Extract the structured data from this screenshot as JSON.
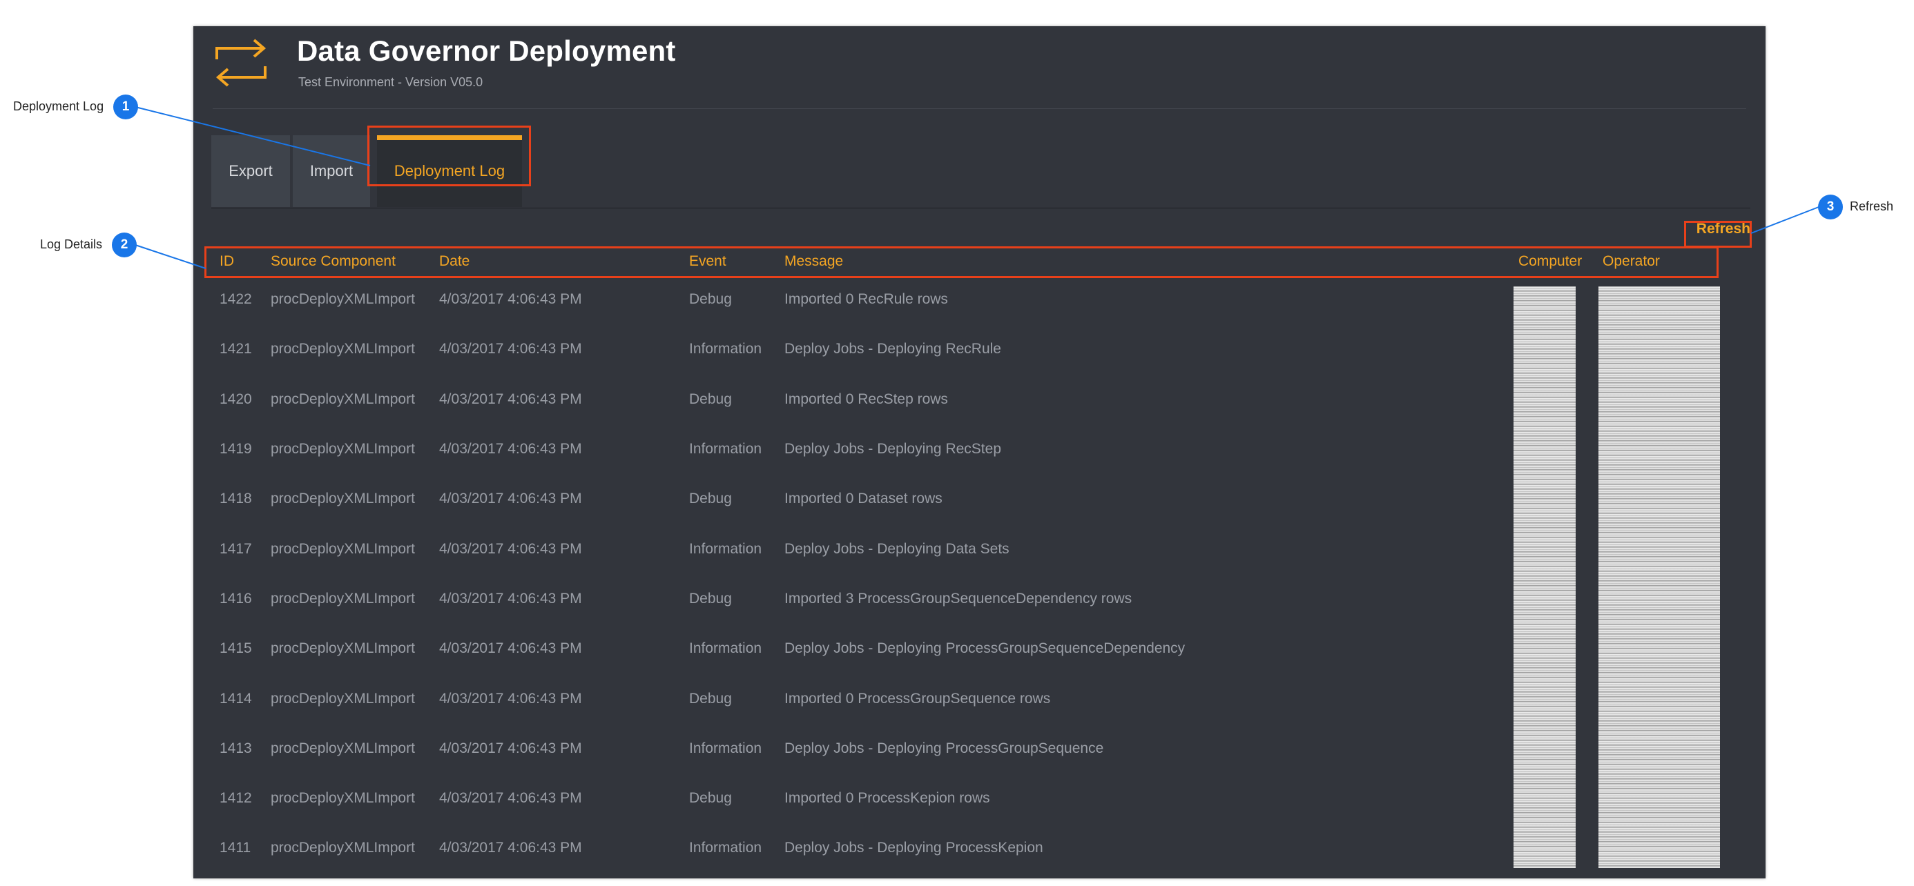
{
  "app": {
    "title": "Data Governor Deployment",
    "subtitle": "Test Environment - Version V05.0",
    "icon": "transfer-arrows-icon",
    "accent_color": "#f5a623"
  },
  "tabs": [
    {
      "label": "Export",
      "active": false
    },
    {
      "label": "Import",
      "active": false
    },
    {
      "label": "Deployment Log",
      "active": true
    }
  ],
  "refresh_label": "Refresh",
  "log": {
    "columns": [
      "ID",
      "Source Component",
      "Date",
      "Event",
      "Message",
      "Computer",
      "Operator"
    ],
    "rows": [
      {
        "id": "1422",
        "source": "procDeployXMLImport",
        "date": "4/03/2017 4:06:43 PM",
        "event": "Debug",
        "message": "Imported 0 RecRule rows"
      },
      {
        "id": "1421",
        "source": "procDeployXMLImport",
        "date": "4/03/2017 4:06:43 PM",
        "event": "Information",
        "message": "Deploy Jobs - Deploying RecRule"
      },
      {
        "id": "1420",
        "source": "procDeployXMLImport",
        "date": "4/03/2017 4:06:43 PM",
        "event": "Debug",
        "message": "Imported 0 RecStep rows"
      },
      {
        "id": "1419",
        "source": "procDeployXMLImport",
        "date": "4/03/2017 4:06:43 PM",
        "event": "Information",
        "message": "Deploy Jobs - Deploying RecStep"
      },
      {
        "id": "1418",
        "source": "procDeployXMLImport",
        "date": "4/03/2017 4:06:43 PM",
        "event": "Debug",
        "message": "Imported 0 Dataset rows"
      },
      {
        "id": "1417",
        "source": "procDeployXMLImport",
        "date": "4/03/2017 4:06:43 PM",
        "event": "Information",
        "message": "Deploy Jobs - Deploying Data Sets"
      },
      {
        "id": "1416",
        "source": "procDeployXMLImport",
        "date": "4/03/2017 4:06:43 PM",
        "event": "Debug",
        "message": "Imported 3 ProcessGroupSequenceDependency rows"
      },
      {
        "id": "1415",
        "source": "procDeployXMLImport",
        "date": "4/03/2017 4:06:43 PM",
        "event": "Information",
        "message": "Deploy Jobs - Deploying ProcessGroupSequenceDependency"
      },
      {
        "id": "1414",
        "source": "procDeployXMLImport",
        "date": "4/03/2017 4:06:43 PM",
        "event": "Debug",
        "message": "Imported 0 ProcessGroupSequence rows"
      },
      {
        "id": "1413",
        "source": "procDeployXMLImport",
        "date": "4/03/2017 4:06:43 PM",
        "event": "Information",
        "message": "Deploy Jobs - Deploying ProcessGroupSequence"
      },
      {
        "id": "1412",
        "source": "procDeployXMLImport",
        "date": "4/03/2017 4:06:43 PM",
        "event": "Debug",
        "message": "Imported 0 ProcessKepion rows"
      },
      {
        "id": "1411",
        "source": "procDeployXMLImport",
        "date": "4/03/2017 4:06:43 PM",
        "event": "Information",
        "message": "Deploy Jobs - Deploying ProcessKepion"
      }
    ]
  },
  "annotations": [
    {
      "number": "1",
      "label": "Deployment Log"
    },
    {
      "number": "2",
      "label": "Log Details"
    },
    {
      "number": "3",
      "label": "Refresh"
    }
  ],
  "colors": {
    "panel_bg": "#32353c",
    "highlight": "#e8401a",
    "callout": "#1976e8"
  }
}
